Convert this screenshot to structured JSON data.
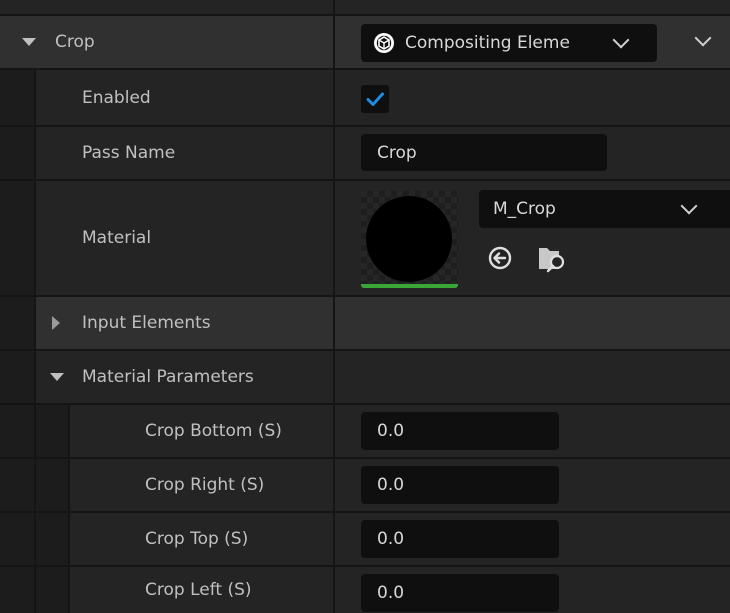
{
  "header": {
    "title": "Crop",
    "class_selector": {
      "icon": "unreal-logo-icon",
      "value": "Compositing Eleme"
    }
  },
  "enabled": {
    "label": "Enabled",
    "checked": true
  },
  "pass_name": {
    "label": "Pass Name",
    "value": "Crop"
  },
  "material": {
    "label": "Material",
    "asset": "M_Crop",
    "icons": [
      "use-selected-arrow-icon",
      "browse-folder-icon"
    ]
  },
  "input_elements": {
    "label": "Input Elements",
    "expanded": false
  },
  "material_parameters": {
    "label": "Material Parameters",
    "expanded": true,
    "params": [
      {
        "label": "Crop Bottom (S)",
        "value": "0.0"
      },
      {
        "label": "Crop Right (S)",
        "value": "0.0"
      },
      {
        "label": "Crop Top (S)",
        "value": "0.0"
      },
      {
        "label": "Crop Left (S)",
        "value": "0.0"
      }
    ]
  },
  "colors": {
    "accent_check": "#1e8de0",
    "thumbnail_bar": "#3aa63a",
    "row_bg": "#242424",
    "header_bg": "#303030"
  }
}
